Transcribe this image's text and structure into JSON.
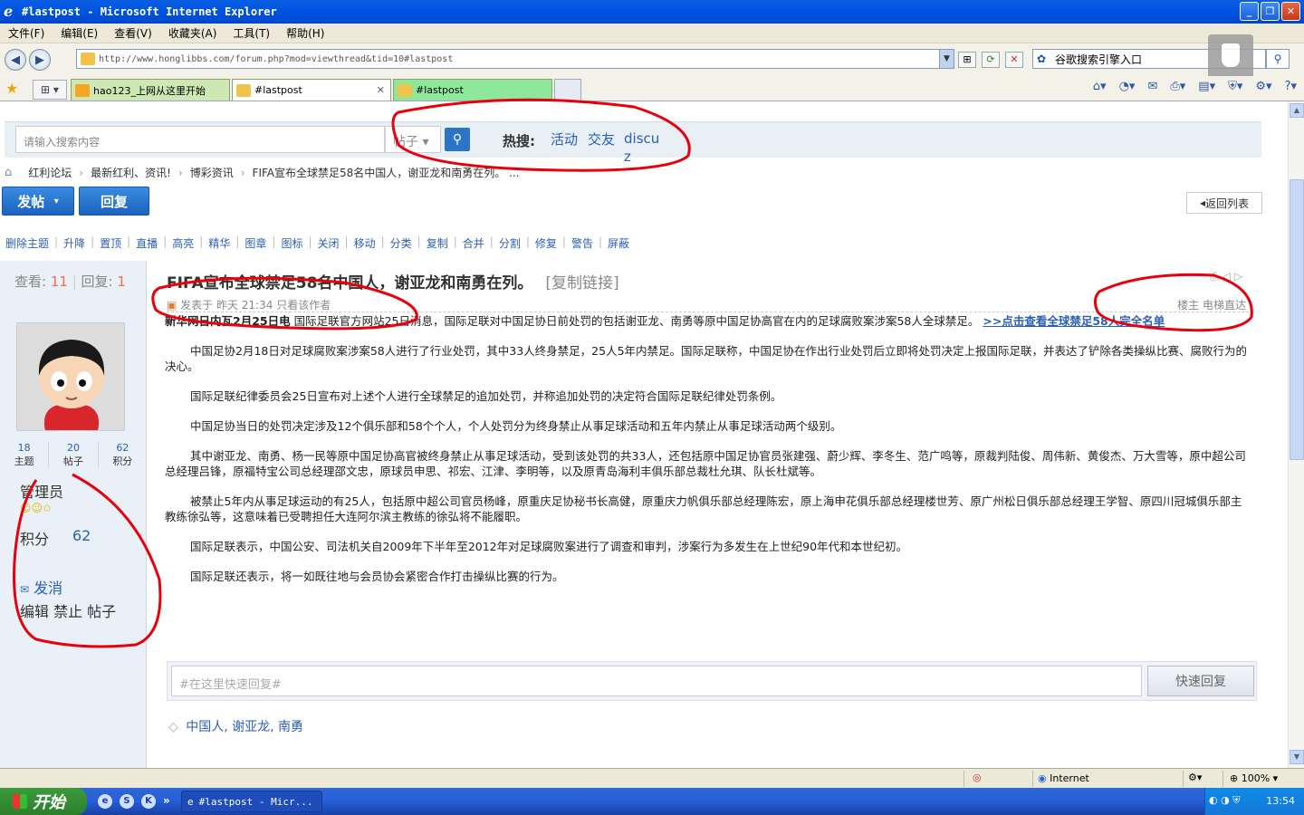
{
  "window": {
    "title": "#lastpost - Microsoft Internet Explorer"
  },
  "menu": [
    "文件(F)",
    "编辑(E)",
    "查看(V)",
    "收藏夹(A)",
    "工具(T)",
    "帮助(H)"
  ],
  "address": {
    "url": "http://www.honglibbs.com/forum.php?mod=viewthread&tid=10#lastpost"
  },
  "browser_search": {
    "value": "谷歌搜索引擎入口"
  },
  "tabs": [
    {
      "label": "hao123_上网从这里开始"
    },
    {
      "label": "#lastpost",
      "close": "✕"
    },
    {
      "label": "#lastpost"
    }
  ],
  "forum_search": {
    "placeholder": "请输入搜索内容",
    "type": "帖子",
    "hot_label": "热搜:",
    "hot": [
      "活动",
      "交友",
      "discuz"
    ]
  },
  "breadcrumb": [
    "红利论坛",
    "最新红利、资讯!",
    "博彩资讯",
    "FIFA宣布全球禁足58名中国人，谢亚龙和南勇在列。  ..."
  ],
  "actions": {
    "post": "发帖",
    "reply": "回复",
    "back": "返回列表"
  },
  "mod_tools": [
    "删除主题",
    "升降",
    "置顶",
    "直播",
    "高亮",
    "精华",
    "图章",
    "图标",
    "关闭",
    "移动",
    "分类",
    "复制",
    "合并",
    "分割",
    "修复",
    "警告",
    "屏蔽"
  ],
  "thread": {
    "views_label": "查看:",
    "views": "11",
    "replies_label": "回复:",
    "replies": "1",
    "title": "FIFA宣布全球禁足58名中国人，谢亚龙和南勇在列。",
    "copy_link": "[复制链接]",
    "meta_left": "发表于 昨天 21:34  只看该作者",
    "meta_right": "楼主  电梯直达"
  },
  "author": {
    "counts": [
      {
        "value": "18",
        "label": "主题"
      },
      {
        "value": "20",
        "label": "帖子"
      },
      {
        "value": "62",
        "label": "积分"
      }
    ],
    "role": "管理员",
    "points_label": "积分",
    "points": "62",
    "message": "发消",
    "actions": "编辑 禁止 帖子"
  },
  "article": {
    "lead": "新华网日内瓦2月25日电",
    "lead_text": "  国际足联官方网站25日消息，国际足联对中国足协日前处罚的包括谢亚龙、南勇等原中国足协高官在内的足球腐败案涉案58人全球禁足。",
    "lead_link": ">>点击查看全球禁足58人完全名单",
    "paragraphs": [
      "中国足协2月18日对足球腐败案涉案58人进行了行业处罚，其中33人终身禁足，25人5年内禁足。国际足联称，中国足协在作出行业处罚后立即将处罚决定上报国际足联，并表达了铲除各类操纵比赛、腐败行为的决心。",
      "国际足联纪律委员会25日宣布对上述个人进行全球禁足的追加处罚，并称追加处罚的决定符合国际足联纪律处罚条例。",
      "中国足协当日的处罚决定涉及12个俱乐部和58个个人，个人处罚分为终身禁止从事足球活动和五年内禁止从事足球活动两个级别。",
      "其中谢亚龙、南勇、杨一民等原中国足协高官被终身禁止从事足球活动，受到该处罚的共33人，还包括原中国足协官员张建强、蔚少辉、李冬生、范广鸣等，原裁判陆俊、周伟新、黄俊杰、万大雪等，原中超公司总经理吕锋，原福特宝公司总经理邵文忠，原球员申思、祁宏、江津、李明等，以及原青岛海利丰俱乐部总裁杜允琪、队长杜斌等。",
      "被禁止5年内从事足球运动的有25人，包括原中超公司官员杨峰，原重庆足协秘书长高健，原重庆力帆俱乐部总经理陈宏，原上海申花俱乐部总经理楼世芳、原广州松日俱乐部总经理王学智、原四川冠城俱乐部主教练徐弘等，这意味着已受聘担任大连阿尔滨主教练的徐弘将不能履职。",
      "国际足联表示，中国公安、司法机关自2009年下半年至2012年对足球腐败案进行了调查和审判，涉案行为多发生在上世纪90年代和本世纪初。",
      "国际足联还表示，将一如既往地与会员协会紧密合作打击操纵比赛的行为。"
    ],
    "tags": "中国人, 谢亚龙, 南勇"
  },
  "quick_reply": {
    "placeholder": "#在这里快速回复#",
    "button": "快速回复"
  },
  "status": {
    "zone": "Internet",
    "zoom": "100%"
  },
  "taskbar": {
    "start": "开始",
    "task": "#lastpost - Micr...",
    "clock": "13:54"
  },
  "colors": {
    "link": "#2b5fb5",
    "annotation": "#e8000d",
    "accent": "#2b74c7"
  }
}
